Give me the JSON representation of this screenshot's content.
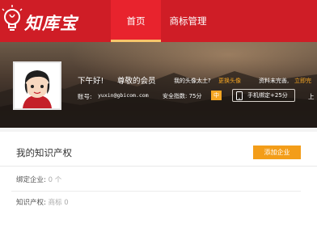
{
  "brand": {
    "name": "知库宝",
    "colors": {
      "primary": "#cf1d26",
      "accent": "#f39d19"
    }
  },
  "nav": {
    "tabs": [
      {
        "label": "首页",
        "active": true
      },
      {
        "label": "商标管理",
        "active": false
      }
    ]
  },
  "profile": {
    "greeting": "下午好!",
    "respected": "尊敬的会员",
    "avatar_prompt": "我的头像太土?",
    "change_avatar": "更换头像",
    "incomplete_notice": "资料未完善,",
    "complete_link": "立即完",
    "account_label": "账号:",
    "account_value": "yuxin@gbicom.com",
    "security_label": "安全指数: 75分",
    "security_level": "中",
    "phone_bind": "手机绑定+25分",
    "last_login_fragment": "上"
  },
  "main": {
    "title": "我的知识产权",
    "add_button": "添加企业",
    "rows": [
      {
        "label": "绑定企业:",
        "value": "0 个"
      },
      {
        "label": "知识产权:",
        "value": "商标 0"
      }
    ]
  }
}
